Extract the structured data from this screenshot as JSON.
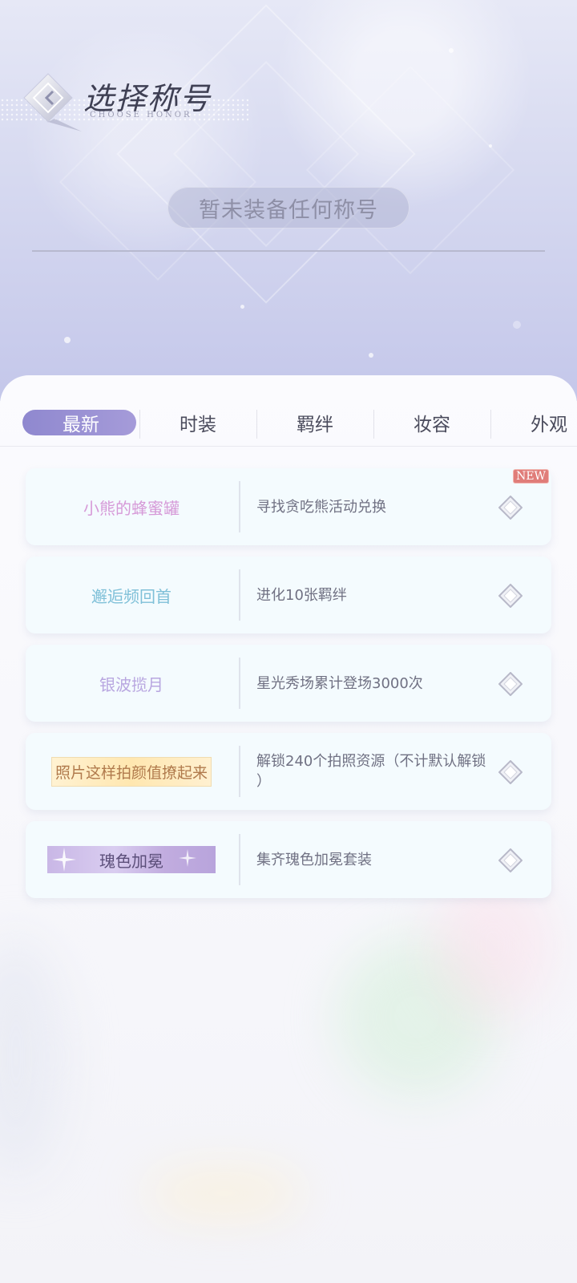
{
  "header": {
    "title": "选择称号",
    "subtitle": "CHOOSE HONOR",
    "current_honor": "暂未装备任何称号"
  },
  "tabs": [
    {
      "label": "最新",
      "active": true
    },
    {
      "label": "时装",
      "active": false
    },
    {
      "label": "羁绊",
      "active": false
    },
    {
      "label": "妆容",
      "active": false
    },
    {
      "label": "外观",
      "active": false
    }
  ],
  "honors": [
    {
      "name": "小熊的蜂蜜罐",
      "desc": "寻找贪吃熊活动兑换",
      "is_new": true,
      "new_label": "NEW",
      "name_color": "#d69ad8"
    },
    {
      "name": "邂逅频回首",
      "desc": "进化10张羁绊",
      "is_new": false,
      "name_color": "#7fc0d8"
    },
    {
      "name": "银波揽月",
      "desc": "星光秀场累计登场3000次",
      "is_new": false,
      "name_color": "#b8a6e0"
    },
    {
      "name": "照片这样拍颜值撩起来",
      "desc": "解锁240个拍照资源（不计默认解锁 ）",
      "is_new": false,
      "name_color": "#b07a4c"
    },
    {
      "name": "瑰色加冕",
      "desc": "集齐瑰色加冕套装",
      "is_new": false,
      "name_color": "#5c4f7a"
    }
  ],
  "icons": {
    "back": "back-arrow-icon",
    "equip": "diamond-icon"
  },
  "colors": {
    "accent": "#978fd2",
    "card_bg": "#f4fbfe"
  }
}
